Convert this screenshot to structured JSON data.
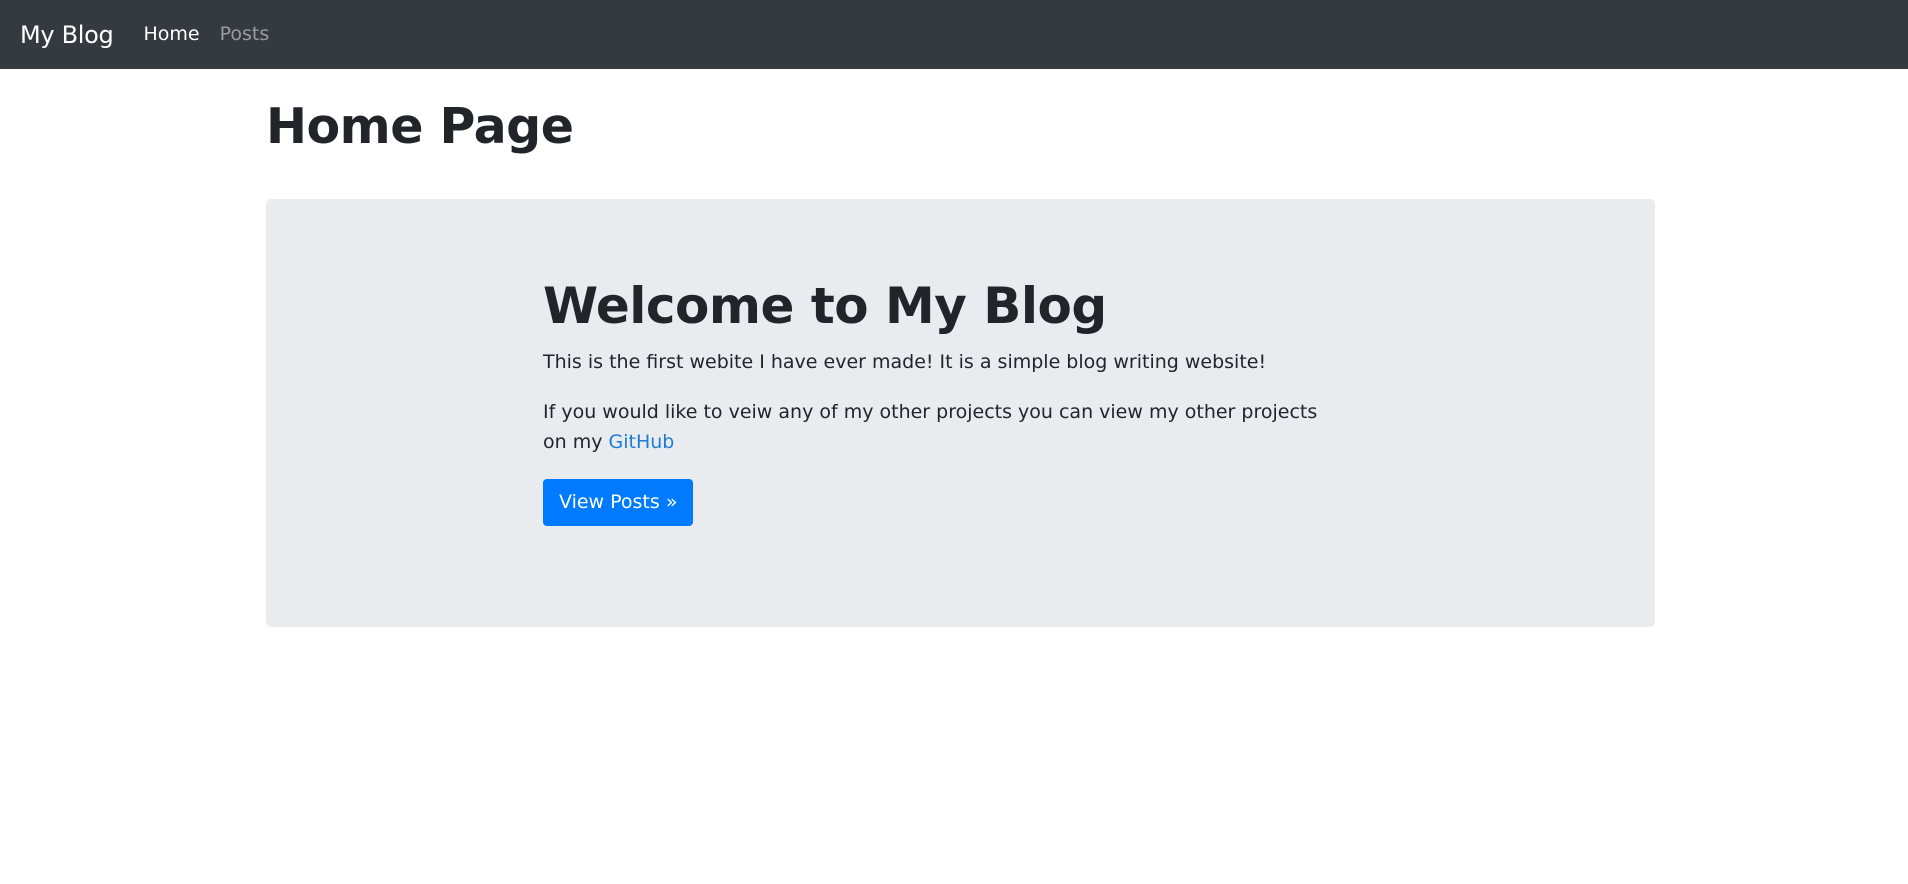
{
  "navbar": {
    "brand": "My Blog",
    "links": [
      {
        "label": "Home",
        "active": true
      },
      {
        "label": "Posts",
        "active": false
      }
    ]
  },
  "main": {
    "title": "Home Page",
    "jumbotron": {
      "heading": "Welcome to My Blog",
      "paragraph1": "This is the first webite I have ever made! It is a simple blog writing website!",
      "paragraph2_prefix": "If you would like to veiw any of my other projects you can view my other projects on my ",
      "github_label": "GitHub",
      "button_label": "View Posts »"
    }
  },
  "colors": {
    "navbar_bg": "#343a40",
    "jumbotron_bg": "#e9ecef",
    "primary": "#007bff",
    "link": "#1f7cd6"
  }
}
